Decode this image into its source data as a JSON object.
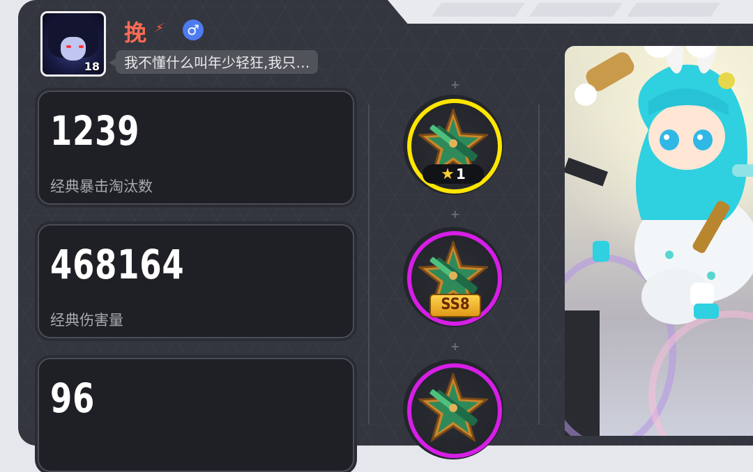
{
  "profile": {
    "username": "挽",
    "rank_mark": "⚡",
    "gender_symbol": "♂",
    "level": "18",
    "motto": "我不懂什么叫年少轻狂,我只…"
  },
  "stats": [
    {
      "value": "1239",
      "label": "经典暴击淘汰数"
    },
    {
      "value": "468164",
      "label": "经典伤害量"
    },
    {
      "value": "96",
      "label": ""
    }
  ],
  "medals": [
    {
      "ring_color": "#ffe600",
      "icon": "sniper-rifle-star-medal-icon",
      "tag": "1",
      "tag_type": "star"
    },
    {
      "ring_color": "#d61ee6",
      "icon": "sniper-rifle-star-medal-icon",
      "tag": "SS8",
      "tag_type": "ss"
    },
    {
      "ring_color": "#d61ee6",
      "icon": "sniper-rifle-star-medal-icon",
      "tag": "",
      "tag_type": "none"
    }
  ],
  "colors": {
    "username": "#ff6b54",
    "gender_badge": "#4d7cf0",
    "panel": "#33363f",
    "card": "#1f2026"
  }
}
